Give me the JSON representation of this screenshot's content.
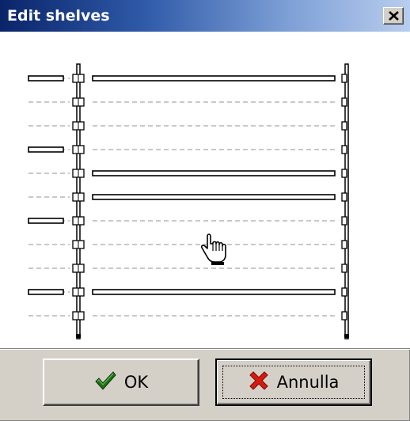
{
  "window": {
    "title": "Edit shelves",
    "close_icon": "close-icon"
  },
  "shelf_editor": {
    "rows": [
      {
        "left_shelf": true,
        "main_shelf": true
      },
      {
        "left_shelf": false,
        "main_shelf": false
      },
      {
        "left_shelf": false,
        "main_shelf": false
      },
      {
        "left_shelf": true,
        "main_shelf": false
      },
      {
        "left_shelf": false,
        "main_shelf": true
      },
      {
        "left_shelf": false,
        "main_shelf": true
      },
      {
        "left_shelf": true,
        "main_shelf": false
      },
      {
        "left_shelf": false,
        "main_shelf": false
      },
      {
        "left_shelf": false,
        "main_shelf": false
      },
      {
        "left_shelf": true,
        "main_shelf": true
      },
      {
        "left_shelf": false,
        "main_shelf": false
      }
    ],
    "cursor_icon": "hand-pointer-icon"
  },
  "buttons": {
    "ok_label": "OK",
    "ok_icon": "checkmark-icon",
    "cancel_label": "Annulla",
    "cancel_icon": "red-x-icon"
  },
  "colors": {
    "titlebar_start": "#0a246a",
    "titlebar_end": "#b9cdee",
    "dialog_face": "#d4d0c8",
    "check_green": "#1f6e16",
    "cancel_red": "#d71a0e"
  }
}
